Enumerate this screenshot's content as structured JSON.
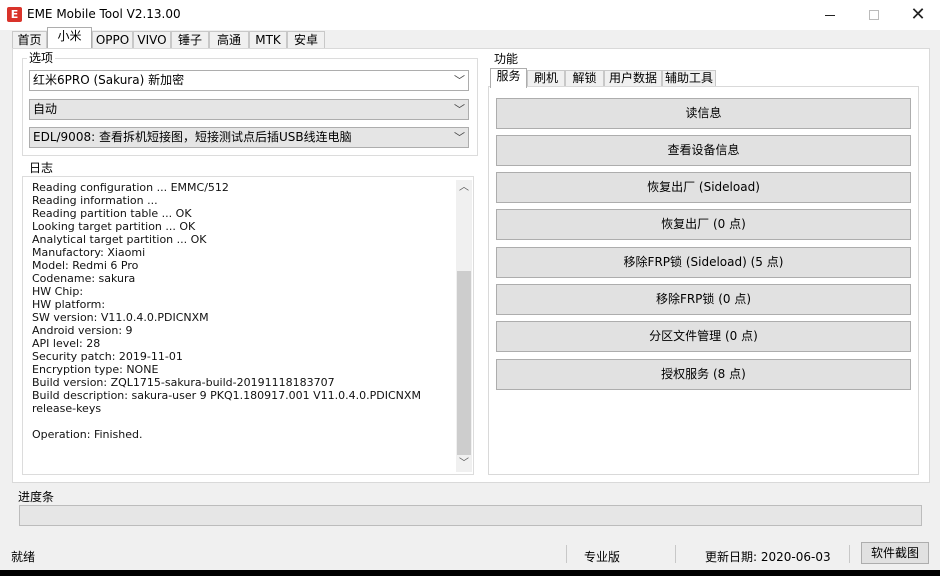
{
  "window": {
    "icon_letter": "E",
    "title": "EME Mobile Tool V2.13.00"
  },
  "main_tabs": [
    "首页",
    "小米",
    "OPPO",
    "VIVO",
    "锤子",
    "高通",
    "MTK",
    "安卓"
  ],
  "options": {
    "label": "选项",
    "model_combo": "红米6PRO (Sakura) 新加密",
    "mode_combo": "自动",
    "edl_combo": "EDL/9008: 查看拆机短接图，短接测试点后插USB线连电脑"
  },
  "log": {
    "label": "日志",
    "text": "Reading configuration ... EMMC/512\nReading information ...\nReading partition table ... OK\nLooking target partition ... OK\nAnalytical target partition ... OK\nManufactory: Xiaomi\nModel: Redmi 6 Pro\nCodename: sakura\nHW Chip:\nHW platform:\nSW version: V11.0.4.0.PDICNXM\nAndroid version: 9\nAPI level: 28\nSecurity patch: 2019-11-01\nEncryption type: NONE\nBuild version: ZQL1715-sakura-build-20191118183707\nBuild description: sakura-user 9 PKQ1.180917.001 V11.0.4.0.PDICNXM release-keys\n\nOperation: Finished."
  },
  "functions": {
    "label": "功能",
    "tabs": [
      "服务",
      "刷机",
      "解锁",
      "用户数据",
      "辅助工具"
    ],
    "buttons": [
      "读信息",
      "查看设备信息",
      "恢复出厂 (Sideload)",
      "恢复出厂 (0 点)",
      "移除FRP锁 (Sideload) (5 点)",
      "移除FRP锁 (0 点)",
      "分区文件管理 (0 点)",
      "授权服务 (8 点)"
    ]
  },
  "progress": {
    "label": "进度条",
    "value": 0
  },
  "status": {
    "state": "就绪",
    "edition": "专业版",
    "update_date": "更新日期: 2020-06-03",
    "screenshot_button": "软件截图"
  }
}
